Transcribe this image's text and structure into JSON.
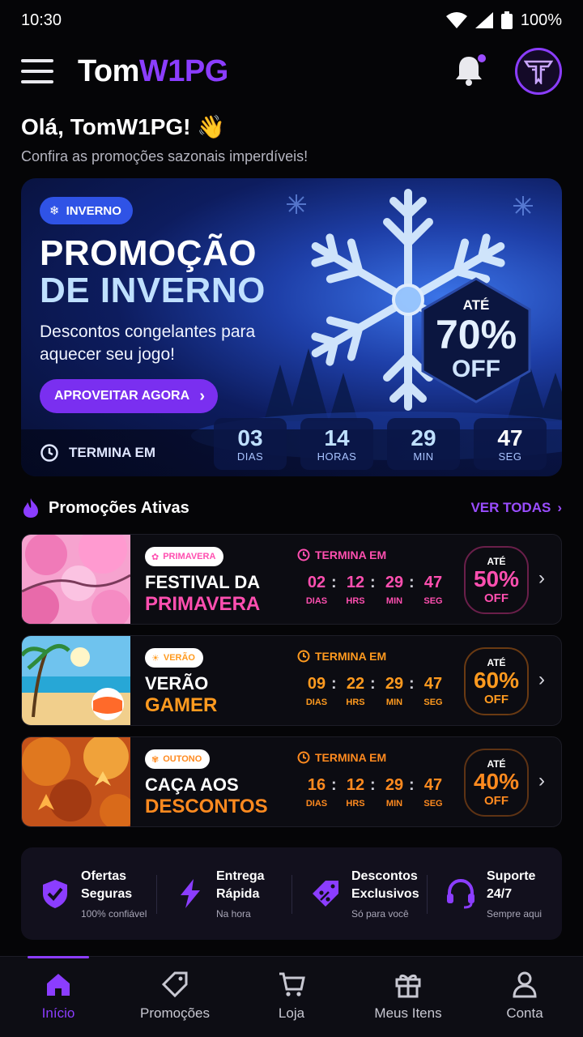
{
  "status_bar": {
    "time": "10:30",
    "battery": "100%"
  },
  "header": {
    "logo_part1": "Tom",
    "logo_part2": "W1PG",
    "accent": "#8b3dff"
  },
  "greeting": {
    "title": "Olá, TomW1PG! 👋",
    "subtitle": "Confira as promoções sazonais imperdíveis!"
  },
  "hero": {
    "tag": "INVERNO",
    "title_line1": "PROMOÇÃO",
    "title_line2": "DE INVERNO",
    "description": "Descontos congelantes para aquecer seu jogo!",
    "cta": "APROVEITAR AGORA",
    "badge_prefix": "ATÉ",
    "badge_value": "70%",
    "badge_suffix": "OFF",
    "ends_label": "TERMINA EM",
    "countdown": [
      {
        "value": "03",
        "unit": "DIAS"
      },
      {
        "value": "14",
        "unit": "HORAS"
      },
      {
        "value": "29",
        "unit": "MIN"
      },
      {
        "value": "47",
        "unit": "SEG"
      }
    ]
  },
  "section": {
    "title": "Promoções Ativas",
    "see_all": "VER TODAS"
  },
  "promos": [
    {
      "tag": "PRIMAVERA",
      "title1": "FESTIVAL DA",
      "title2": "PRIMAVERA",
      "color": "#ff4fb0",
      "ends_label": "TERMINA EM",
      "timer": [
        {
          "value": "02",
          "unit": "DIAS"
        },
        {
          "value": "12",
          "unit": "HRS"
        },
        {
          "value": "29",
          "unit": "MIN"
        },
        {
          "value": "47",
          "unit": "SEG"
        }
      ],
      "badge_prefix": "ATÉ",
      "badge_value": "50%",
      "badge_suffix": "OFF"
    },
    {
      "tag": "VERÃO",
      "title1": "VERÃO",
      "title2": "GAMER",
      "color": "#ff9a1f",
      "ends_label": "TERMINA EM",
      "timer": [
        {
          "value": "09",
          "unit": "DIAS"
        },
        {
          "value": "22",
          "unit": "HRS"
        },
        {
          "value": "29",
          "unit": "MIN"
        },
        {
          "value": "47",
          "unit": "SEG"
        }
      ],
      "badge_prefix": "ATÉ",
      "badge_value": "60%",
      "badge_suffix": "OFF"
    },
    {
      "tag": "OUTONO",
      "title1": "CAÇA AOS",
      "title2": "DESCONTOS",
      "color": "#ff8a1f",
      "ends_label": "TERMINA EM",
      "timer": [
        {
          "value": "16",
          "unit": "DIAS"
        },
        {
          "value": "12",
          "unit": "HRS"
        },
        {
          "value": "29",
          "unit": "MIN"
        },
        {
          "value": "47",
          "unit": "SEG"
        }
      ],
      "badge_prefix": "ATÉ",
      "badge_value": "40%",
      "badge_suffix": "OFF"
    }
  ],
  "features": [
    {
      "title_line1": "Ofertas",
      "title_line2": "Seguras",
      "caption": "100% confiável",
      "icon": "shield-check-icon"
    },
    {
      "title_line1": "Entrega",
      "title_line2": "Rápida",
      "caption": "Na hora",
      "icon": "lightning-icon"
    },
    {
      "title_line1": "Descontos",
      "title_line2": "Exclusivos",
      "caption": "Só para você",
      "icon": "percent-tag-icon"
    },
    {
      "title_line1": "Suporte",
      "title_line2": "24/7",
      "caption": "Sempre aqui",
      "icon": "headset-icon"
    }
  ],
  "nav": [
    {
      "label": "Início",
      "icon": "home-icon",
      "active": true
    },
    {
      "label": "Promoções",
      "icon": "tag-icon",
      "active": false
    },
    {
      "label": "Loja",
      "icon": "cart-icon",
      "active": false
    },
    {
      "label": "Meus Itens",
      "icon": "gift-icon",
      "active": false
    },
    {
      "label": "Conta",
      "icon": "user-icon",
      "active": false
    }
  ]
}
